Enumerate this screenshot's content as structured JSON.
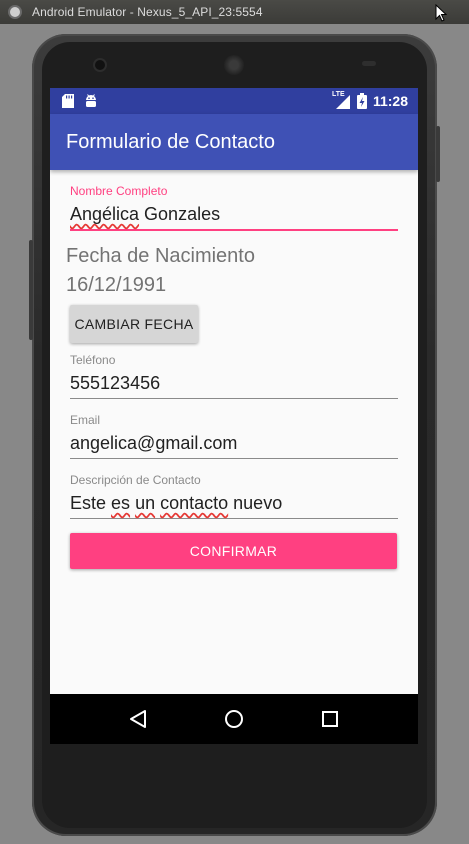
{
  "window": {
    "title": "Android Emulator - Nexus_5_API_23:5554"
  },
  "statusbar": {
    "left_icons": [
      "sd-card-icon",
      "android-icon"
    ],
    "network_type": "LTE",
    "time": "11:28"
  },
  "appbar": {
    "title": "Formulario de Contacto"
  },
  "form": {
    "name_label": "Nombre Completo",
    "name_word1": "Angélica",
    "name_word2": " Gonzales",
    "birth_label": "Fecha de Nacimiento",
    "birth_date": "16/12/1991",
    "change_date_button": "CAMBIAR FECHA",
    "phone_label": "Teléfono",
    "phone_value": "555123456",
    "email_label": "Email",
    "email_value": "angelica@gmail.com",
    "description_label": "Descripción de Contacto",
    "description_parts": {
      "p1": "Este ",
      "p2": "es",
      "p3": " ",
      "p4": "un",
      "p5": " ",
      "p6": "contacto",
      "p7": " nuevo"
    },
    "confirm_button": "CONFIRMAR"
  },
  "navbar": {
    "icons": [
      "back-icon",
      "home-icon",
      "recents-icon"
    ]
  },
  "colors": {
    "primary": "#3f51b5",
    "primary_dark": "#303f9f",
    "accent": "#ff4081"
  }
}
